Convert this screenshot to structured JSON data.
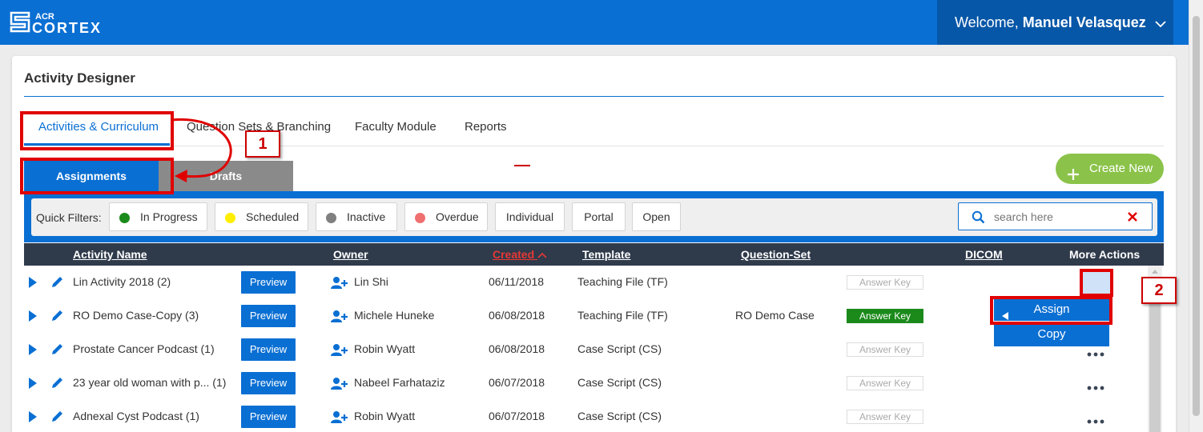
{
  "header": {
    "logo_top": "ACR",
    "logo_main": "CORTEX",
    "welcome_prefix": "Welcome,",
    "user_name": "Manuel Velasquez"
  },
  "page": {
    "title": "Activity Designer"
  },
  "tabs": [
    {
      "label": "Activities & Curriculum"
    },
    {
      "label": "Question Sets & Branching"
    },
    {
      "label": "Faculty Module"
    },
    {
      "label": "Reports"
    }
  ],
  "subtabs": [
    {
      "label": "Assignments"
    },
    {
      "label": "Drafts"
    }
  ],
  "create_button": {
    "label": "Create New"
  },
  "filters": {
    "label": "Quick Filters:",
    "chips": [
      {
        "label": "In Progress",
        "color": "#1a8a1a"
      },
      {
        "label": "Scheduled",
        "color": "#ffee00"
      },
      {
        "label": "Inactive",
        "color": "#808080"
      },
      {
        "label": "Overdue",
        "color": "#f07070"
      },
      {
        "label": "Individual"
      },
      {
        "label": "Portal"
      },
      {
        "label": "Open"
      }
    ]
  },
  "search": {
    "placeholder": "search here"
  },
  "table": {
    "headers": {
      "activity": "Activity Name",
      "owner": "Owner",
      "created": "Created",
      "template": "Template",
      "question_set": "Question-Set",
      "dicom": "DICOM",
      "more": "More Actions"
    },
    "preview_label": "Preview",
    "answer_key_label": "Answer Key",
    "rows": [
      {
        "name": "Lin Activity 2018 (2)",
        "owner": "Lin Shi",
        "created": "06/11/2018",
        "template": "Teaching File (TF)",
        "question_set": "",
        "answer_key_active": false
      },
      {
        "name": "RO Demo Case-Copy (3)",
        "owner": "Michele Huneke",
        "created": "06/08/2018",
        "template": "Teaching File (TF)",
        "question_set": "RO Demo Case",
        "answer_key_active": true
      },
      {
        "name": "Prostate Cancer Podcast (1)",
        "owner": "Robin Wyatt",
        "created": "06/08/2018",
        "template": "Case Script (CS)",
        "question_set": "",
        "answer_key_active": false
      },
      {
        "name": "23 year old woman with p...  (1)",
        "owner": "Nabeel Farhataziz",
        "created": "06/07/2018",
        "template": "Case Script (CS)",
        "question_set": "",
        "answer_key_active": false
      },
      {
        "name": "Adnexal Cyst Podcast (1)",
        "owner": "Robin Wyatt",
        "created": "06/07/2018",
        "template": "Case Script (CS)",
        "question_set": "",
        "answer_key_active": false
      }
    ]
  },
  "menu": {
    "assign": "Assign",
    "copy": "Copy"
  },
  "callouts": {
    "one": "1",
    "two": "2"
  },
  "colors": {
    "primary": "#0a6fd3",
    "header_dark": "#0757a8",
    "table_head": "#2f3a4b",
    "create": "#8bc34a",
    "annotation": "#e00000"
  }
}
